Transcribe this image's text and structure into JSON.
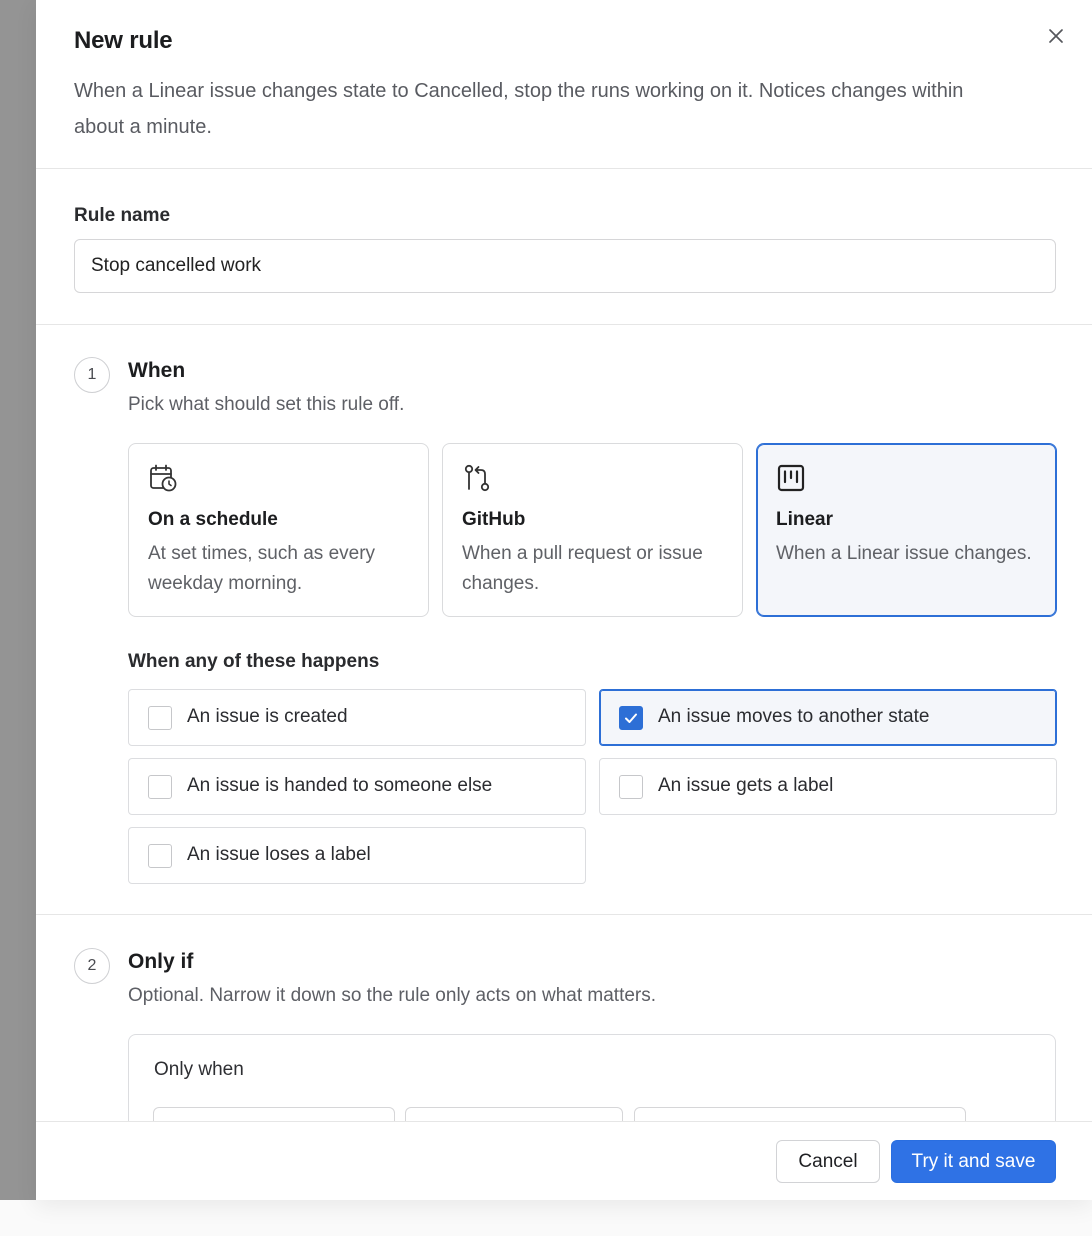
{
  "dialog": {
    "title": "New rule",
    "description": "When a Linear issue changes state to Cancelled, stop the runs working on it. Notices changes within about a minute.",
    "close_icon": "close-icon"
  },
  "rule_name": {
    "label": "Rule name",
    "value": "Stop cancelled work"
  },
  "step_when": {
    "number": "1",
    "title": "When",
    "subtitle": "Pick what should set this rule off.",
    "triggers": [
      {
        "title": "On a schedule",
        "description": "At set times, such as every weekday morning.",
        "icon": "calendar-clock-icon",
        "selected": false
      },
      {
        "title": "GitHub",
        "description": "When a pull request or issue changes.",
        "icon": "git-pull-request-icon",
        "selected": false
      },
      {
        "title": "Linear",
        "description": "When a Linear issue changes.",
        "icon": "board-icon",
        "selected": true
      }
    ],
    "events_heading": "When any of these happens",
    "events": [
      {
        "label": "An issue is created",
        "checked": false
      },
      {
        "label": "An issue moves to another state",
        "checked": true
      },
      {
        "label": "An issue is handed to someone else",
        "checked": false
      },
      {
        "label": "An issue gets a label",
        "checked": false
      },
      {
        "label": "An issue loses a label",
        "checked": false
      }
    ]
  },
  "step_only_if": {
    "number": "2",
    "title": "Only if",
    "subtitle": "Optional. Narrow it down so the rule only acts on what matters.",
    "box_label": "Only when"
  },
  "footer": {
    "cancel_label": "Cancel",
    "save_label": "Try it and save"
  },
  "colors": {
    "accent": "#2f72e5",
    "selected_border": "#2d6fd6",
    "selected_bg": "#f4f6fa"
  }
}
